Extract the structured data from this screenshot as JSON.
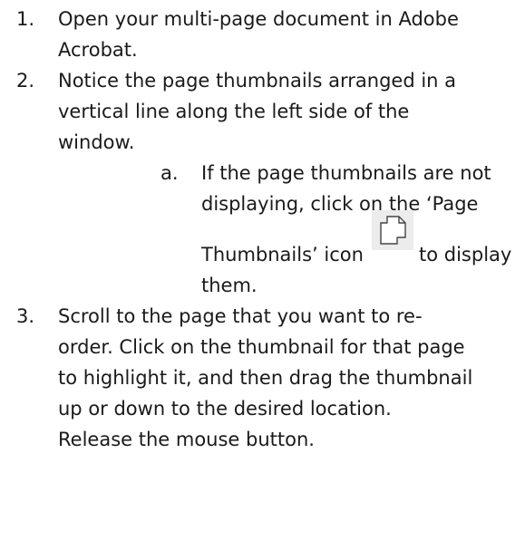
{
  "steps": [
    {
      "number": "1.",
      "lines": [
        "Open your multi-page document in Adobe",
        "Acrobat."
      ]
    },
    {
      "number": "2.",
      "lines": [
        "Notice the page thumbnails arranged in a",
        "vertical line along the left side of the",
        "window."
      ],
      "substeps": [
        {
          "letter": "a.",
          "lines": [
            "If the page thumbnails are not",
            "displaying, click on the ‘Page"
          ],
          "icon_line_before": "Thumbnails’ icon",
          "icon_name": "page-thumbnails-icon",
          "icon_line_after": "to display",
          "last_line": "them."
        }
      ]
    },
    {
      "number": "3.",
      "lines": [
        "Scroll to the page that you want to re-",
        "order. Click on the thumbnail for that page",
        "to highlight it, and then drag the thumbnail",
        "up or down to the desired location.",
        "Release the mouse button."
      ]
    }
  ]
}
